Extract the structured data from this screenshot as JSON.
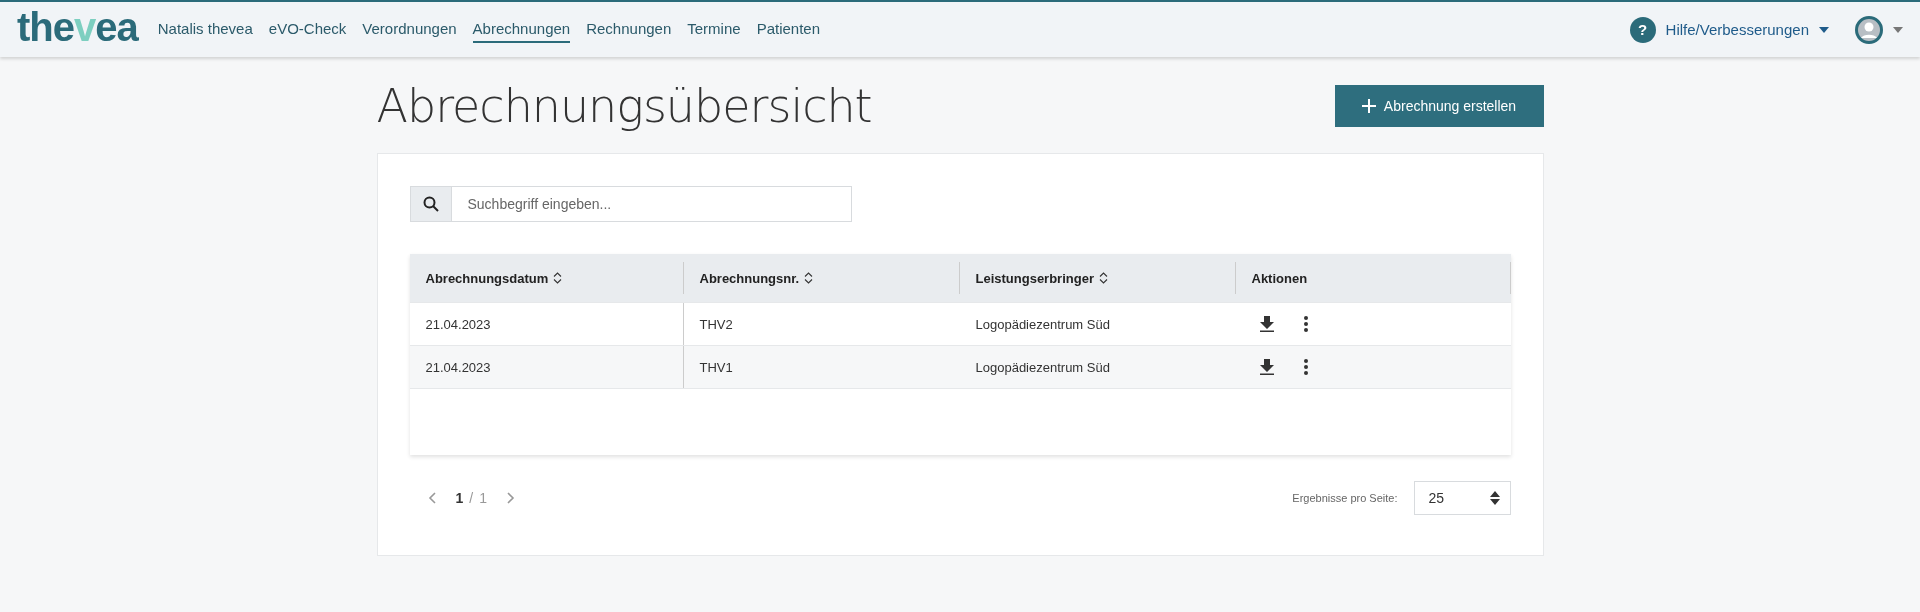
{
  "header": {
    "logo": [
      {
        "text": "the",
        "accent": false
      },
      {
        "text": "v",
        "accent": true
      },
      {
        "text": "ea",
        "accent": false
      }
    ],
    "nav": [
      {
        "label": "Natalis thevea",
        "selected": false
      },
      {
        "label": "eVO-Check",
        "selected": false
      },
      {
        "label": "Verordnungen",
        "selected": false
      },
      {
        "label": "Abrechnungen",
        "selected": true
      },
      {
        "label": "Rechnungen",
        "selected": false
      },
      {
        "label": "Termine",
        "selected": false
      },
      {
        "label": "Patienten",
        "selected": false
      }
    ],
    "help": {
      "icon_text": "?",
      "label": "Hilfe/Verbesserungen"
    }
  },
  "page": {
    "title": "Abrechnungsübersicht",
    "create_button": "Abrechnung erstellen"
  },
  "search": {
    "placeholder": "Suchbegriff eingeben..."
  },
  "table": {
    "columns": [
      {
        "label": "Abrechnungsdatum",
        "sortable": true
      },
      {
        "label": "Abrechnungsnr.",
        "sortable": true
      },
      {
        "label": "Leistungserbringer",
        "sortable": true
      },
      {
        "label": "Aktionen",
        "sortable": false
      }
    ],
    "rows": [
      {
        "cells": [
          "21.04.2023",
          "THV2",
          "Logopädiezentrum Süd"
        ]
      },
      {
        "cells": [
          "21.04.2023",
          "THV1",
          "Logopädiezentrum Süd"
        ]
      }
    ]
  },
  "pagination": {
    "current": "1",
    "separator": "/",
    "total": "1",
    "page_size_label": "Ergebnisse pro Seite:",
    "page_size": "25"
  }
}
